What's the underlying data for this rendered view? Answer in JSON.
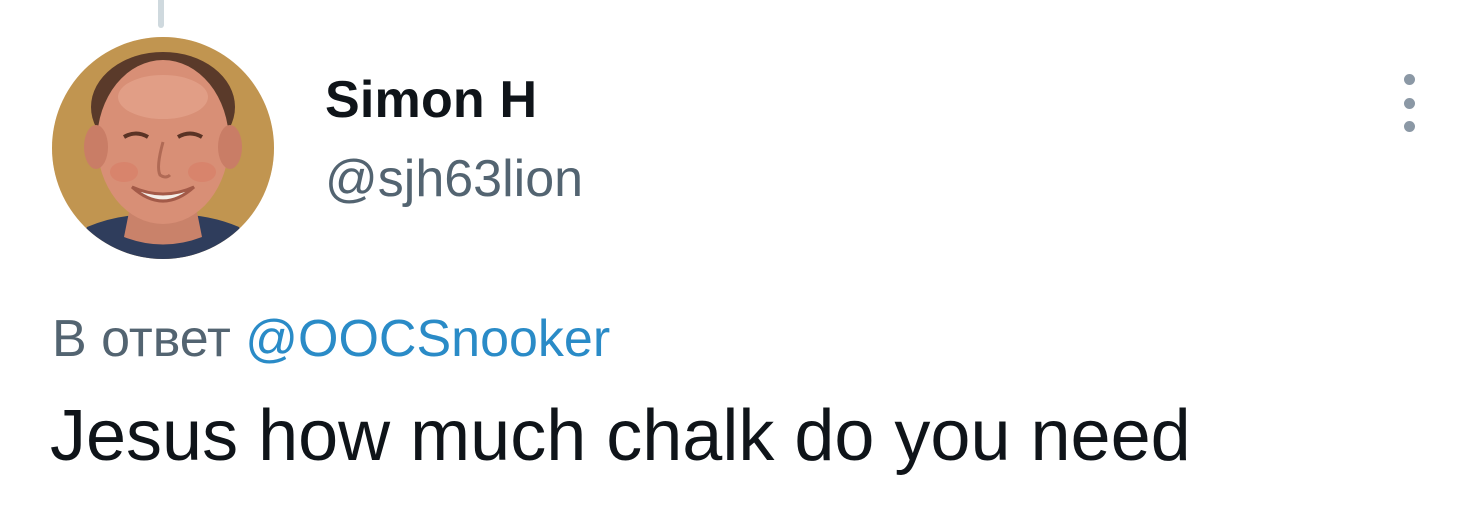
{
  "tweet": {
    "author": {
      "display_name": "Simon H",
      "handle": "@sjh63lion",
      "avatar": "profile-photo"
    },
    "more_icon": "more-vertical-icon",
    "reply_to": {
      "prefix": "В ответ",
      "mention": "@OOCSnooker"
    },
    "text": "Jesus how much chalk do you need"
  },
  "colors": {
    "text_primary": "#0f1419",
    "text_secondary": "#536471",
    "link": "#2a8bc7",
    "thread_line": "#cfd9de"
  }
}
